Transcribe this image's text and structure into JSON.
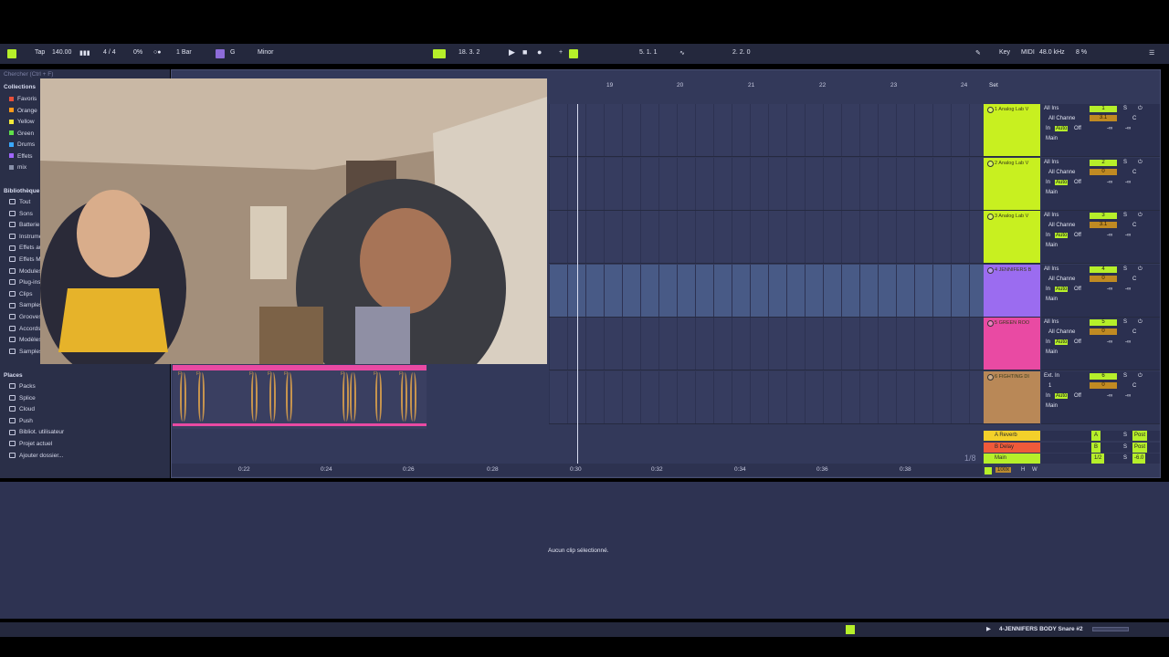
{
  "topbar": {
    "tap": "Tap",
    "tempo": "140.00",
    "signature": "4 / 4",
    "cpu_percent": "0%",
    "quantize": "1 Bar",
    "key_root": "G",
    "scale": "Minor",
    "position": "18. 3. 2",
    "loop_start": "5. 1. 1",
    "loop_length": "2. 2. 0",
    "key_label": "Key",
    "midi_label": "MIDI",
    "sample_rate": "48.0 kHz",
    "cpu_load": "8 %"
  },
  "browser": {
    "search_placeholder": "Chercher (Ctrl + F)",
    "collections_title": "Collections",
    "collections": [
      {
        "label": "Favoris",
        "color": "#e8503a"
      },
      {
        "label": "Orange",
        "color": "#ff9a1a"
      },
      {
        "label": "Yellow",
        "color": "#f3e93a"
      },
      {
        "label": "Green",
        "color": "#5fe04a"
      },
      {
        "label": "Drums",
        "color": "#3aa8ff"
      },
      {
        "label": "Effets",
        "color": "#a066ff"
      },
      {
        "label": "mix",
        "color": "#8890aa"
      }
    ],
    "library_title": "Bibliothèque",
    "library": [
      "Tout",
      "Sons",
      "Batterie",
      "Instruments",
      "Effets audio",
      "Effets MIDI",
      "Modules Max",
      "Plug-ins",
      "Clips",
      "Samples",
      "Grooves",
      "Accords",
      "Modèles",
      "Samples"
    ],
    "places_title": "Places",
    "places": [
      "Packs",
      "Splice",
      "Cloud",
      "Push",
      "Bibliot. utilisateur",
      "Projet actuel",
      "Ajouter dossier..."
    ]
  },
  "arrangement": {
    "bar_numbers": [
      "19",
      "20",
      "21",
      "22",
      "23",
      "24"
    ],
    "set_label": "Set",
    "time_markers": [
      "0:22",
      "0:24",
      "0:26",
      "0:28",
      "0:30",
      "0:32",
      "0:34",
      "0:36",
      "0:38"
    ],
    "zoom": "1/8",
    "clip_label": "FI",
    "tracks": [
      {
        "name": "1 Analog Lab V",
        "color": "#c8f020",
        "input": "All Ins",
        "channel": "All Channe",
        "number": "1",
        "pan": "3.1",
        "mon_in": "In",
        "mon_auto": "Auto",
        "mon_off": "Off",
        "out": "Main"
      },
      {
        "name": "2 Analog Lab V",
        "color": "#c8f020",
        "input": "All Ins",
        "channel": "All Channe",
        "number": "2",
        "pan": "0",
        "mon_in": "In",
        "mon_auto": "Auto",
        "mon_off": "Off",
        "out": "Main"
      },
      {
        "name": "3 Analog Lab V",
        "color": "#c8f020",
        "input": "All Ins",
        "channel": "All Channe",
        "number": "3",
        "pan": "3.1",
        "mon_in": "In",
        "mon_auto": "Auto",
        "mon_off": "Off",
        "out": "Main"
      },
      {
        "name": "4 JENNIFERS B",
        "color": "#9b6cf0",
        "input": "All Ins",
        "channel": "All Channe",
        "number": "4",
        "pan": "0",
        "mon_in": "In",
        "mon_auto": "Auto",
        "mon_off": "Off",
        "out": "Main"
      },
      {
        "name": "5 GREEN ROO",
        "color": "#e94aa3",
        "input": "All Ins",
        "channel": "All Channe",
        "number": "5",
        "pan": "0",
        "mon_in": "In",
        "mon_auto": "Auto",
        "mon_off": "Off",
        "out": "Main"
      },
      {
        "name": "6 FIGHTING DI",
        "color": "#b98857",
        "input": "Ext. In",
        "channel": "1",
        "number": "6",
        "pan": "0",
        "mon_in": "In",
        "mon_auto": "Auto",
        "mon_off": "Off",
        "out": "Main"
      }
    ],
    "returns": [
      {
        "name": "A Reverb",
        "color": "#f3d02a",
        "letter": "A",
        "post": "Post"
      },
      {
        "name": "B Delay",
        "color": "#ef5a3a",
        "letter": "B",
        "post": "Post"
      },
      {
        "name": "Main",
        "color": "#b6ef2a",
        "letter": "1/2",
        "post": "-6.0"
      }
    ],
    "solo": "S",
    "center": "C",
    "minus_inf": "-∞",
    "zoom_pct": "100x",
    "h_btn": "H",
    "w_btn": "W"
  },
  "detail": {
    "message": "Aucun clip sélectionné."
  },
  "status": {
    "selected_track": "4-JENNIFERS BODY Snare #2"
  }
}
